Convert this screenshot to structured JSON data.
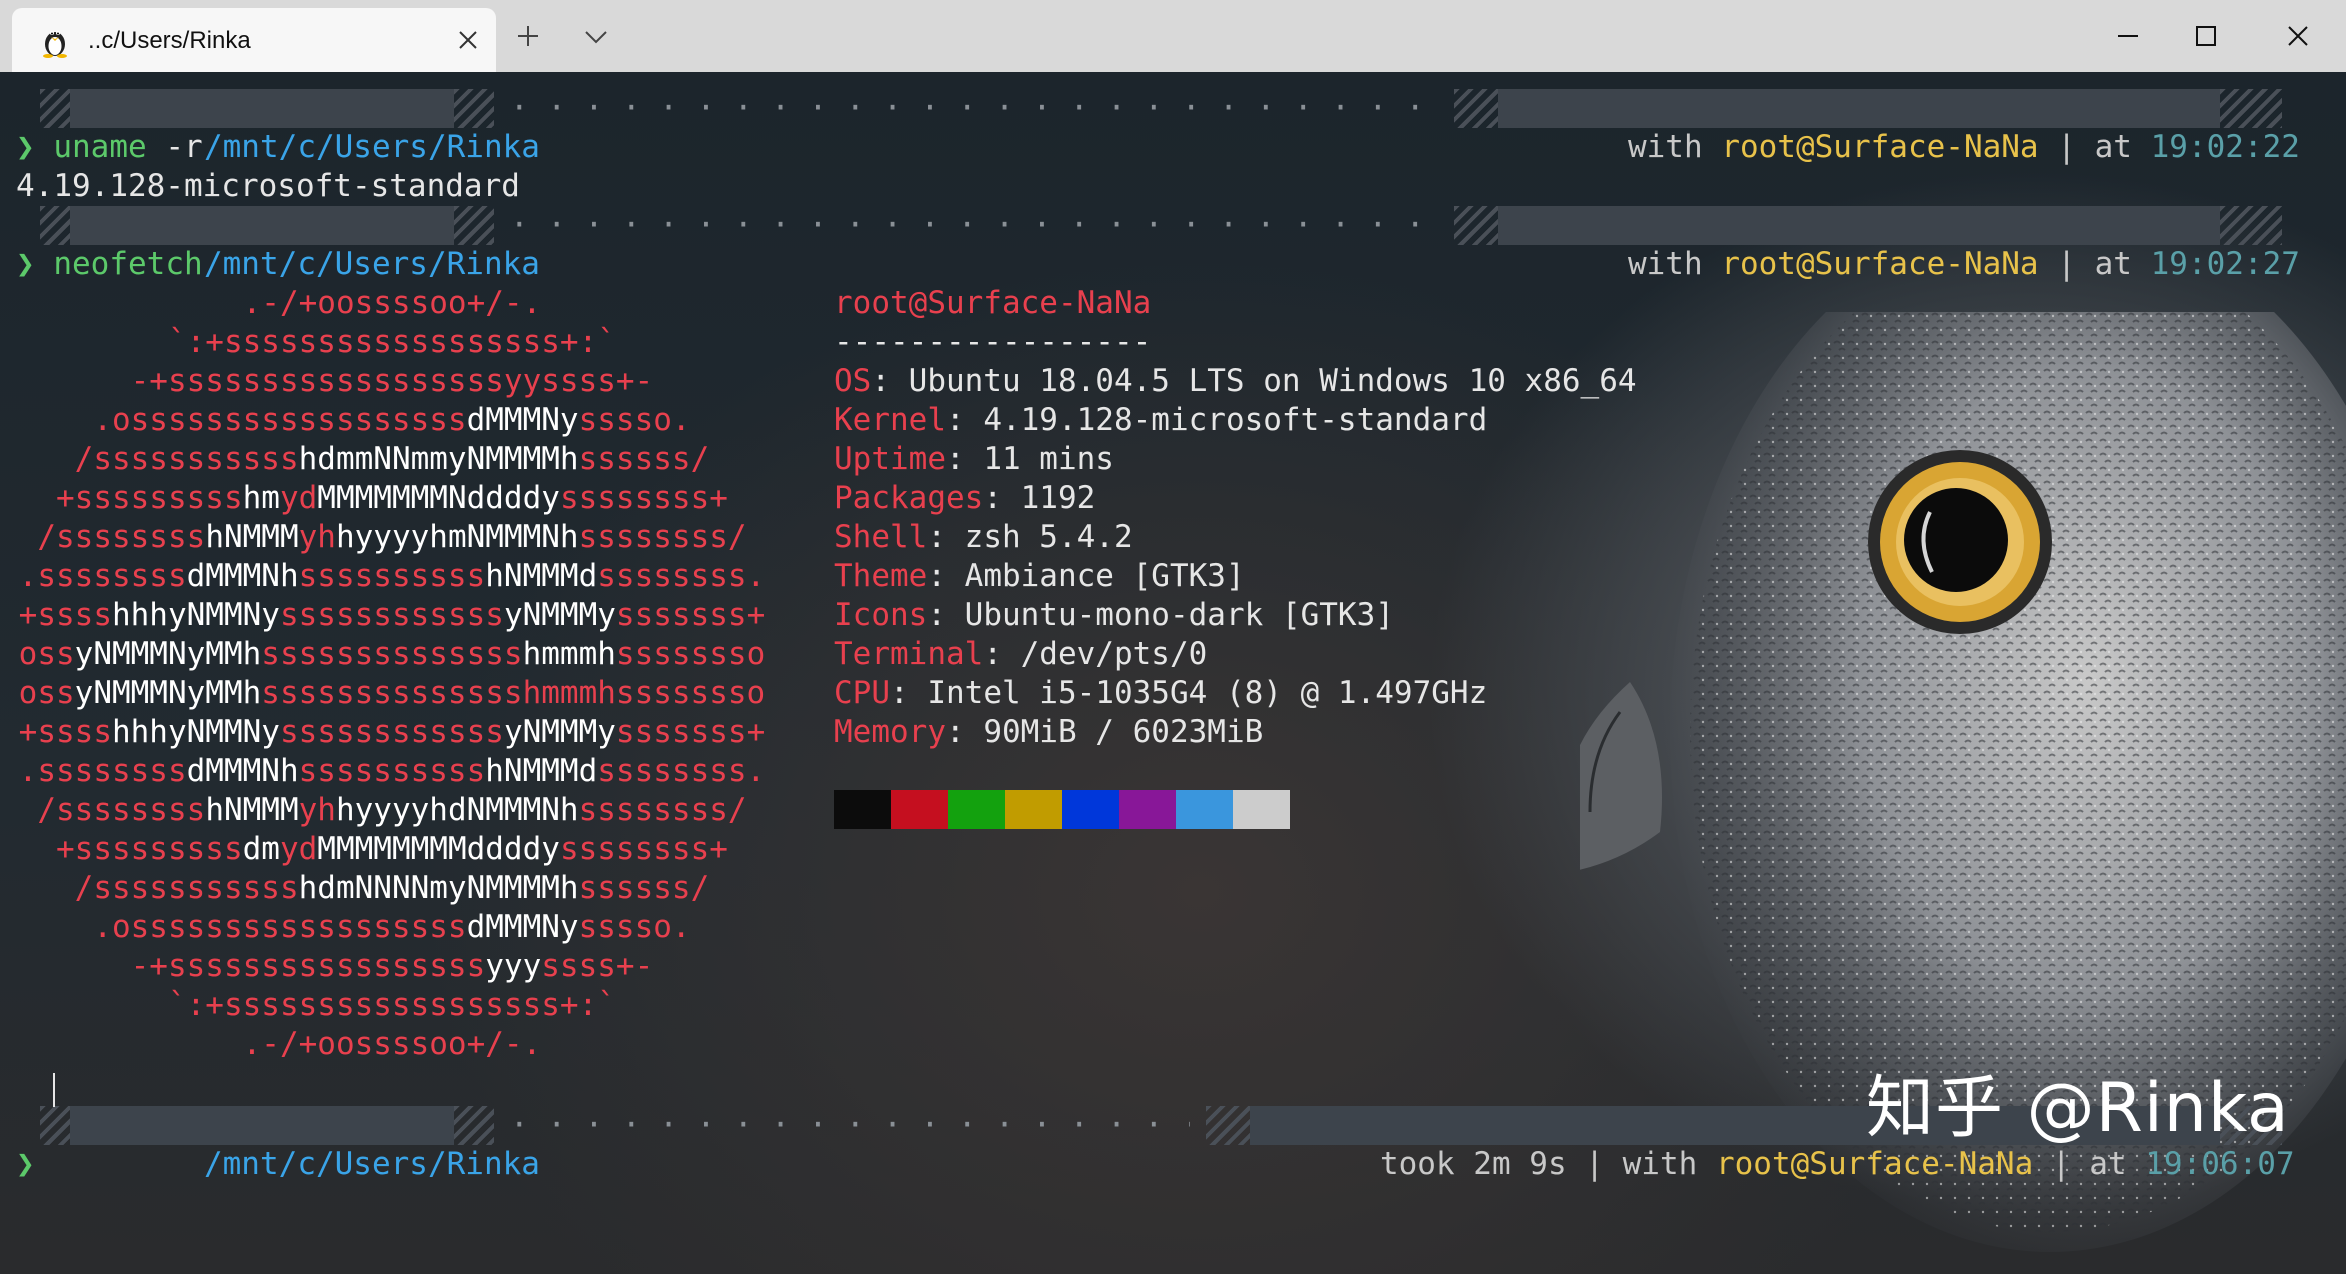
{
  "window": {
    "tab_title": "..c/Users/Rinka"
  },
  "prompts": [
    {
      "path_prefix": "/mnt/",
      "path_mid": "c/",
      "path_mid2": "Users/",
      "path_user": "Rinka",
      "with": "with",
      "user": "root@Surface-NaNa",
      "sep": "|",
      "at": "at",
      "time": "19:02:22",
      "command": "uname",
      "args": " -r"
    },
    {
      "path_prefix": "/mnt/",
      "path_mid": "c/",
      "path_mid2": "Users/",
      "path_user": "Rinka",
      "with": "with",
      "user": "root@Surface-NaNa",
      "sep": "|",
      "at": "at",
      "time": "19:02:27",
      "command": "neofetch",
      "args": ""
    },
    {
      "path_prefix": "/mnt/",
      "path_mid": "c/",
      "path_mid2": "Users/",
      "path_user": "Rinka",
      "took": "took 2m 9s",
      "with": "with",
      "user": "root@Surface-NaNa",
      "sep": "|",
      "at": "at",
      "time": "19:06:07"
    }
  ],
  "prompt_symbol": "❯",
  "uname_output": "4.19.128-microsoft-standard",
  "neofetch": {
    "logo": [
      [
        [
          "r",
          "             .-/+oossssoo+/-."
        ]
      ],
      [
        [
          "r",
          "         `:+ssssssssssssssssss+:`"
        ]
      ],
      [
        [
          "r",
          "       -+ssssssssssssssssssyyssss+-"
        ]
      ],
      [
        [
          "r",
          "     .ossssssssssssssssss"
        ],
        [
          "w",
          "dMMMNy"
        ],
        [
          "r",
          "sssso."
        ]
      ],
      [
        [
          "r",
          "    /sssssssssss"
        ],
        [
          "w",
          "hdmmNNmmyNMMMMh"
        ],
        [
          "r",
          "ssssss/"
        ]
      ],
      [
        [
          "r",
          "   +sssssssss"
        ],
        [
          "w",
          "hm"
        ],
        [
          "r",
          "yd"
        ],
        [
          "w",
          "MMMMMMMNddddy"
        ],
        [
          "r",
          "ssssssss+"
        ]
      ],
      [
        [
          "r",
          "  /ssssssss"
        ],
        [
          "w",
          "hNMMM"
        ],
        [
          "r",
          "yh"
        ],
        [
          "w",
          "hyyyyhmNMMMNh"
        ],
        [
          "r",
          "ssssssss/"
        ]
      ],
      [
        [
          "r",
          " .ssssssss"
        ],
        [
          "w",
          "dMMMNh"
        ],
        [
          "r",
          "ssssssssss"
        ],
        [
          "w",
          "hNMMMd"
        ],
        [
          "r",
          "ssssssss."
        ]
      ],
      [
        [
          "r",
          " +ssss"
        ],
        [
          "w",
          "hhhyNMMNy"
        ],
        [
          "r",
          "ssssssssssss"
        ],
        [
          "w",
          "yNMMMy"
        ],
        [
          "r",
          "sssssss+"
        ]
      ],
      [
        [
          "r",
          " oss"
        ],
        [
          "w",
          "yNMMMNyMMh"
        ],
        [
          "r",
          "ssssssssssssss"
        ],
        [
          "w",
          "hmmmh"
        ],
        [
          "r",
          "ssssssso"
        ]
      ],
      [
        [
          "r",
          " oss"
        ],
        [
          "w",
          "yNMMMNyMMh"
        ],
        [
          "r",
          "sssssssssssssshmmmhssssssso"
        ]
      ],
      [
        [
          "r",
          " +ssss"
        ],
        [
          "w",
          "hhhyNMMNy"
        ],
        [
          "r",
          "ssssssssssss"
        ],
        [
          "w",
          "yNMMMy"
        ],
        [
          "r",
          "sssssss+"
        ]
      ],
      [
        [
          "r",
          " .ssssssss"
        ],
        [
          "w",
          "dMMMNh"
        ],
        [
          "r",
          "ssssssssss"
        ],
        [
          "w",
          "hNMMMd"
        ],
        [
          "r",
          "ssssssss."
        ]
      ],
      [
        [
          "r",
          "  /ssssssss"
        ],
        [
          "w",
          "hNMMM"
        ],
        [
          "r",
          "yh"
        ],
        [
          "w",
          "hyyyyhdNMMMNh"
        ],
        [
          "r",
          "ssssssss/"
        ]
      ],
      [
        [
          "r",
          "   +sssssssss"
        ],
        [
          "w",
          "dm"
        ],
        [
          "r",
          "yd"
        ],
        [
          "w",
          "MMMMMMMMddddy"
        ],
        [
          "r",
          "ssssssss+"
        ]
      ],
      [
        [
          "r",
          "    /sssssssssss"
        ],
        [
          "w",
          "hdmNNNNmyNMMMMh"
        ],
        [
          "r",
          "ssssss/"
        ]
      ],
      [
        [
          "r",
          "     .ossssssssssssssssss"
        ],
        [
          "w",
          "dMMMNy"
        ],
        [
          "r",
          "sssso."
        ]
      ],
      [
        [
          "r",
          "       -+sssssssssssssssss"
        ],
        [
          "w",
          "yyy"
        ],
        [
          "r",
          "ssss+-"
        ]
      ],
      [
        [
          "r",
          "         `:+ssssssssssssssssss+:`"
        ]
      ],
      [
        [
          "r",
          "             .-/+oossssoo+/-."
        ]
      ]
    ],
    "user_host": "root@Surface-NaNa",
    "separator": "-----------------",
    "info": [
      {
        "key": "OS",
        "value": "Ubuntu 18.04.5 LTS on Windows 10 x86_64"
      },
      {
        "key": "Kernel",
        "value": "4.19.128-microsoft-standard"
      },
      {
        "key": "Uptime",
        "value": "11 mins"
      },
      {
        "key": "Packages",
        "value": "1192"
      },
      {
        "key": "Shell",
        "value": "zsh 5.4.2"
      },
      {
        "key": "Theme",
        "value": "Ambiance [GTK3]"
      },
      {
        "key": "Icons",
        "value": "Ubuntu-mono-dark [GTK3]"
      },
      {
        "key": "Terminal",
        "value": "/dev/pts/0"
      },
      {
        "key": "CPU",
        "value": "Intel i5-1035G4 (8) @ 1.497GHz"
      },
      {
        "key": "Memory",
        "value": "90MiB / 6023MiB"
      }
    ],
    "palette": [
      "#0c0c0c",
      "#c50f1f",
      "#13a10e",
      "#c19c00",
      "#0037da",
      "#881798",
      "#3a96dd",
      "#cccccc"
    ]
  },
  "watermark": "知乎 @Rinka",
  "colors": {
    "path": "#3aa4e8",
    "user": "#e8c24a",
    "time": "#5aa0a8",
    "ascii_red": "#e8404e",
    "prompt_green": "#5cc96a"
  }
}
